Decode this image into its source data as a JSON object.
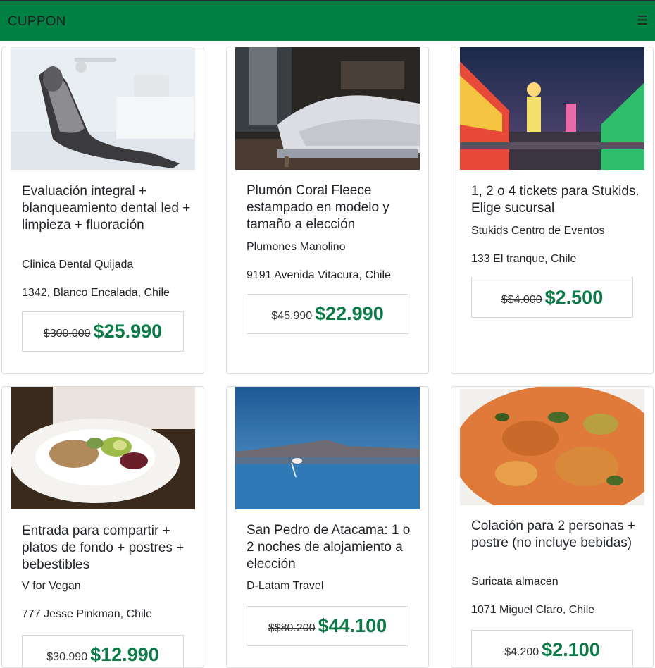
{
  "navbar": {
    "brand": "CUPPON",
    "menu_icon": "hamburger-icon",
    "bg": "#008143"
  },
  "price_color": "#0b7a47",
  "deals": [
    {
      "title": "Evaluación integral + blanqueamiento dental led + limpieza + fluoración",
      "vendor": "Clinica Dental Quijada",
      "address": "1342, Blanco Encalada, Chile",
      "old_price": "$300.000",
      "price": "$25.990"
    },
    {
      "title": "Plumón Coral Fleece estampado en modelo y tamaño a elección",
      "vendor": "Plumones Manolino",
      "address": "9191 Avenida Vitacura, Chile",
      "old_price": "$45.990",
      "price": "$22.990"
    },
    {
      "title": "1, 2 o 4 tickets para Stukids. Elige sucursal",
      "vendor": "Stukids Centro de Eventos",
      "address": "133 El tranque, Chile",
      "old_price": "$$4.000",
      "price": "$2.500"
    },
    {
      "title": "Entrada para compartir + platos de fondo + postres + bebestibles",
      "vendor": "V for Vegan",
      "address": "777 Jesse Pinkman, Chile",
      "old_price": "$30.990",
      "price": "$12.990"
    },
    {
      "title": "San Pedro de Atacama: 1 o 2 noches de alojamiento a elección",
      "vendor": "D-Latam Travel",
      "address": "",
      "old_price": "$$80.200",
      "price": "$44.100"
    },
    {
      "title": "Colación para 2 personas + postre (no incluye bebidas)",
      "vendor": "Suricata almacen",
      "address": "1071 Miguel Claro, Chile",
      "old_price": "$4.200",
      "price": "$2.100"
    }
  ]
}
